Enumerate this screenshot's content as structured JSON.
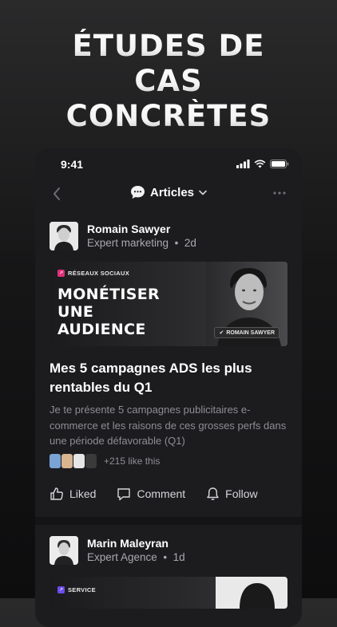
{
  "hero": {
    "lines": [
      "ÉTUDES DE",
      "CAS",
      "CONCRÈTES"
    ]
  },
  "status_bar": {
    "time": "9:41"
  },
  "nav": {
    "title": "Articles",
    "title_icon": "chat-bubble-icon"
  },
  "post": {
    "author": {
      "name": "Romain Sawyer",
      "role": "Expert marketing",
      "age": "2d"
    },
    "banner": {
      "tag": "RÉSEAUX SOCIAUX",
      "title_lines": [
        "MONÉTISER",
        "UNE",
        "AUDIENCE"
      ],
      "name_pill": "ROMAIN SAWYER"
    },
    "headline": "Mes 5 campagnes ADS les plus rentables du Q1",
    "excerpt": "Je te présente 5 campagnes publicitaires e-commerce et les raisons de ces grosses perfs dans une période défavorable (Q1)",
    "likes_text": "+215 like this",
    "actions": {
      "liked": "Liked",
      "comment": "Comment",
      "follow": "Follow"
    }
  },
  "post2": {
    "author": {
      "name": "Marin Maleyran",
      "role": "Expert Agence",
      "age": "1d"
    },
    "banner": {
      "tag": "SERVICE"
    }
  },
  "colors": {
    "accent_tag": "#e0307a",
    "tag_service": "#6b4cf0",
    "background": "#1c1c1f"
  }
}
